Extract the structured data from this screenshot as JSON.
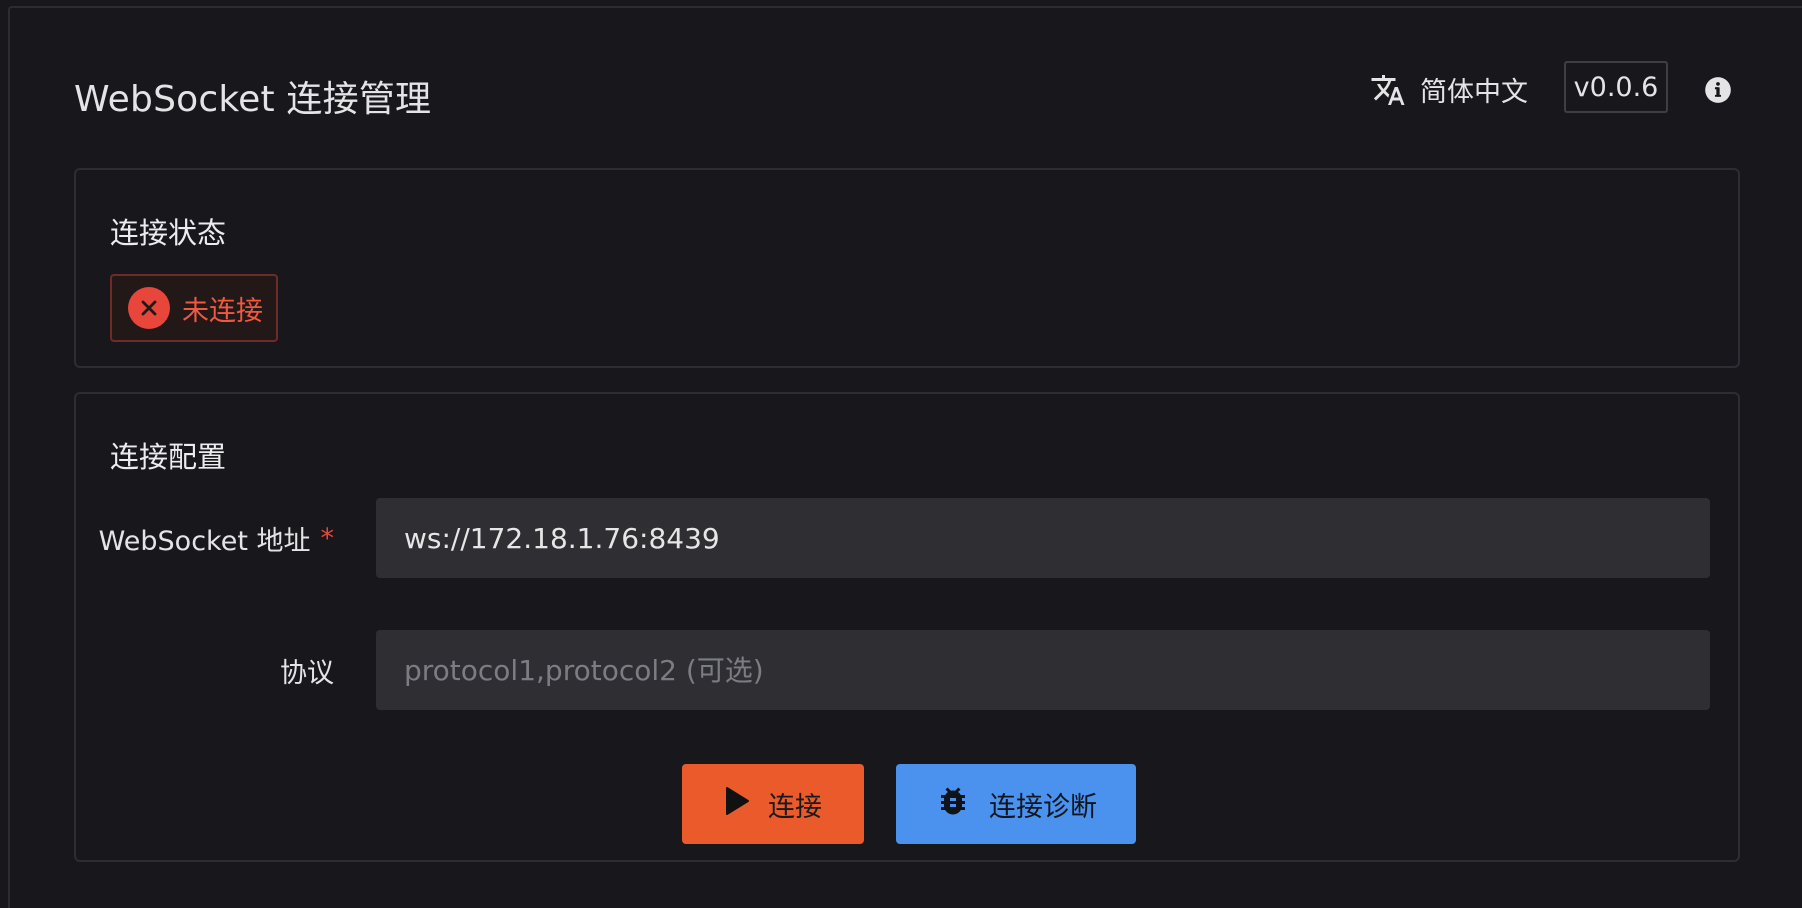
{
  "header": {
    "title": "WebSocket 连接管理",
    "language_label": "简体中文",
    "version": "v0.0.6",
    "language_icon": "translate-icon",
    "info_icon": "info-icon"
  },
  "status_card": {
    "title": "连接状态",
    "status_text": "未连接",
    "status_icon": "close-circle-icon",
    "status_color": "#e8463b"
  },
  "config_card": {
    "title": "连接配置",
    "url_label": "WebSocket 地址",
    "url_required_mark": "*",
    "url_value": "ws://172.18.1.76:8439",
    "protocol_label": "协议",
    "protocol_placeholder": "protocol1,protocol2 (可选)",
    "protocol_value": ""
  },
  "actions": {
    "connect_label": "连接",
    "connect_icon": "play-icon",
    "connect_color": "#ea5a2b",
    "diagnose_label": "连接诊断",
    "diagnose_icon": "bug-icon",
    "diagnose_color": "#4a92ee"
  }
}
